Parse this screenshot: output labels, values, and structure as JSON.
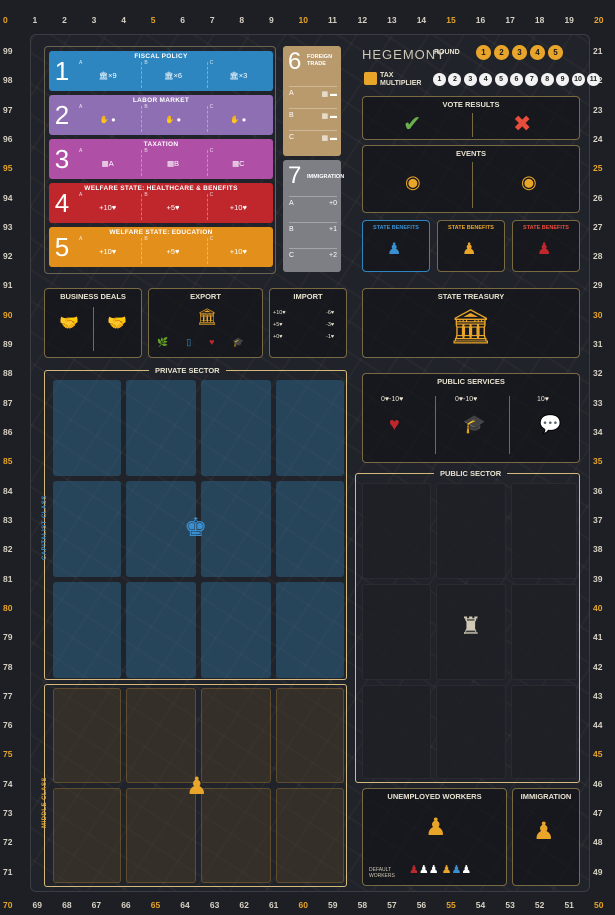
{
  "tracks": {
    "top": [
      "0",
      "1",
      "2",
      "3",
      "4",
      "5",
      "6",
      "7",
      "8",
      "9",
      "10",
      "11",
      "12",
      "13",
      "14",
      "15",
      "16",
      "17",
      "18",
      "19",
      "20"
    ],
    "bottom": [
      "70",
      "69",
      "68",
      "67",
      "66",
      "65",
      "64",
      "63",
      "62",
      "61",
      "60",
      "59",
      "58",
      "57",
      "56",
      "55",
      "54",
      "53",
      "52",
      "51",
      "50"
    ],
    "left": [
      "99",
      "98",
      "97",
      "96",
      "95",
      "94",
      "93",
      "92",
      "91",
      "90",
      "89",
      "88",
      "87",
      "86",
      "85",
      "84",
      "83",
      "82",
      "81",
      "80",
      "79",
      "78",
      "77",
      "76",
      "75",
      "74",
      "73",
      "72",
      "71"
    ],
    "right": [
      "21",
      "22",
      "23",
      "24",
      "25",
      "26",
      "27",
      "28",
      "29",
      "30",
      "31",
      "32",
      "33",
      "34",
      "35",
      "36",
      "37",
      "38",
      "39",
      "40",
      "41",
      "42",
      "43",
      "44",
      "45",
      "46",
      "47",
      "48",
      "49"
    ],
    "highlight_color": "#e8a52a"
  },
  "policies": [
    {
      "num": "1",
      "title": "FISCAL POLICY",
      "opts": [
        "×9",
        "×6",
        "×3"
      ],
      "color": "#2e86c1"
    },
    {
      "num": "2",
      "title": "LABOR MARKET",
      "opts": [
        "",
        "",
        ""
      ],
      "color": "#8e6fb3"
    },
    {
      "num": "3",
      "title": "TAXATION",
      "opts": [
        "A",
        "B",
        "C"
      ],
      "color": "#b04fa6"
    },
    {
      "num": "4",
      "title": "WELFARE STATE: HEALTHCARE & BENEFITS",
      "opts": [
        "+10♥",
        "+5♥",
        "+10♥"
      ],
      "color": "#c0272d"
    },
    {
      "num": "5",
      "title": "WELFARE STATE: EDUCATION",
      "opts": [
        "+10♥",
        "+5♥",
        "+10♥"
      ],
      "color": "#e2901b"
    }
  ],
  "foreign_trade": {
    "num": "6",
    "title": "FOREIGN TRADE",
    "rows": [
      "A",
      "B",
      "C"
    ]
  },
  "immigration_policy": {
    "num": "7",
    "title": "IMMIGRATION",
    "rows": [
      "+0",
      "+1",
      "+2"
    ],
    "labels": [
      "A",
      "B",
      "C"
    ]
  },
  "header": {
    "logo": "HEGEMONY",
    "round_label": "ROUND",
    "rounds": [
      "1",
      "2",
      "3",
      "4",
      "5"
    ],
    "tax_label": "TAX MULTIPLIER",
    "multipliers": [
      "1",
      "2",
      "3",
      "4",
      "5",
      "6",
      "7",
      "8",
      "9",
      "10",
      "11"
    ]
  },
  "panels": {
    "vote_results": "VOTE RESULTS",
    "events": "EVENTS",
    "state_benefits": [
      "STATE BENEFITS",
      "STATE BENEFITS",
      "STATE BENEFITS"
    ],
    "business_deals": "BUSINESS DEALS",
    "export": "EXPORT",
    "import": "IMPORT",
    "import_rows": [
      "+10♥",
      "+5♥",
      "+0♥"
    ],
    "import_costs": [
      "-6♥",
      "-3♥",
      "-1♥"
    ],
    "state_treasury": "STATE TREASURY",
    "public_services": "PUBLIC SERVICES",
    "public_services_values": [
      "0♥-10♥",
      "0♥-10♥",
      "10♥"
    ],
    "unemployed_workers": "UNEMPLOYED WORKERS",
    "immigration": "IMMIGRATION",
    "default_workers": "DEFAULT WORKERS"
  },
  "sectors": {
    "private": "PRIVATE SECTOR",
    "public": "PUBLIC SECTOR",
    "capitalist_class": "CAPITALIST CLASS",
    "middle_class": "MIDDLE CLASS"
  },
  "colors": {
    "accent": "#e8a52a",
    "capitalist": "#3a8fd0",
    "working": "#c0272d"
  }
}
